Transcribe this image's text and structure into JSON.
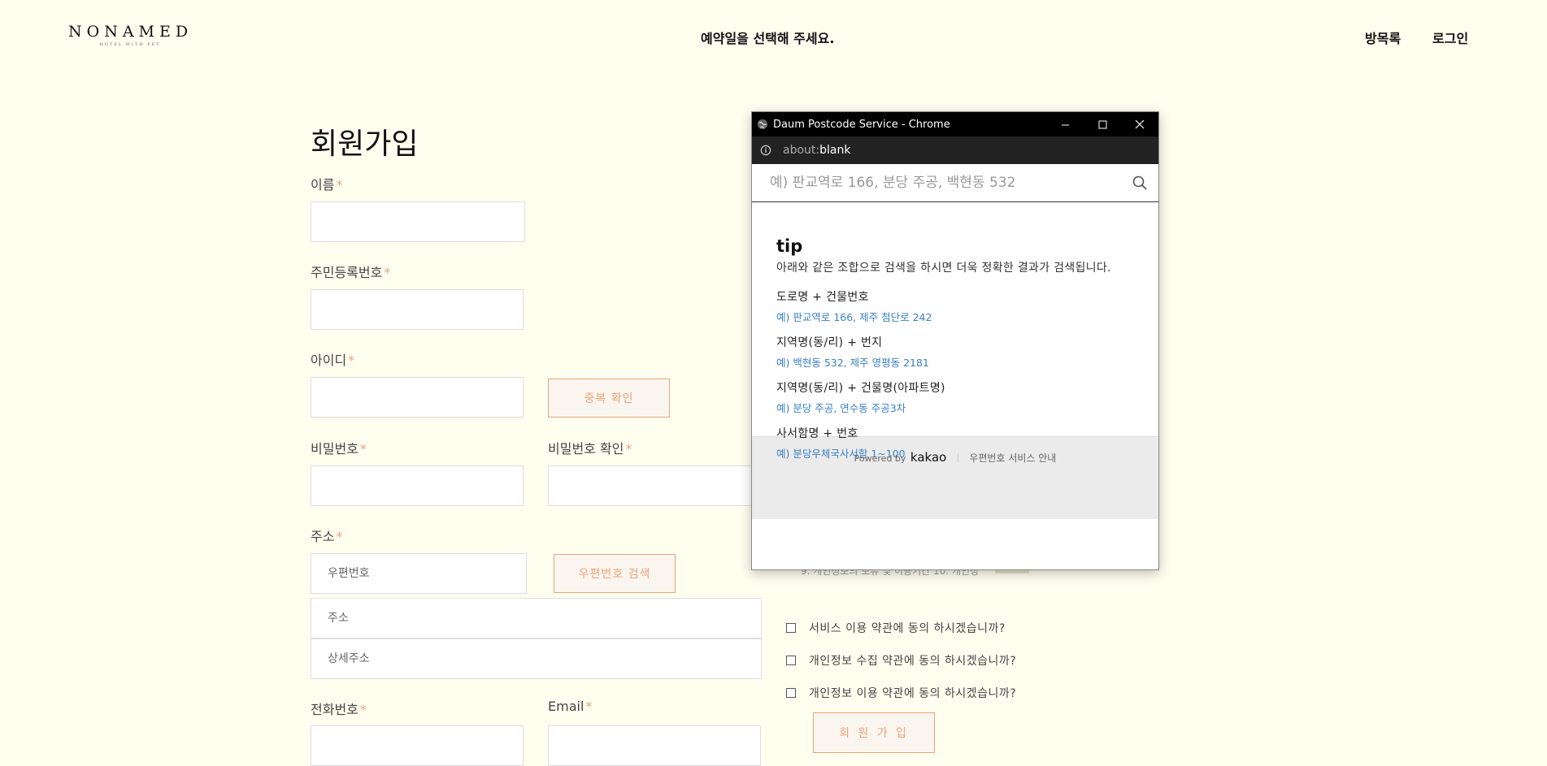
{
  "header": {
    "logo_main": "NONAMED",
    "logo_sub": "HOTEL WITH PET",
    "center_text": "예약일을 선택해 주세요.",
    "nav": [
      "방목록",
      "로그인"
    ]
  },
  "form": {
    "title": "회원가입",
    "required_mark": "*",
    "labels": {
      "name": "이름",
      "rrn": "주민등록번호",
      "id": "아이디",
      "password": "비밀번호",
      "password_confirm": "비밀번호 확인",
      "address": "주소",
      "phone": "전화번호",
      "email": "Email"
    },
    "placeholders": {
      "postcode": "우편번호",
      "address": "주소",
      "address_detail": "상세주소"
    },
    "buttons": {
      "dup_check": "중복 확인",
      "postcode_search": "우편번호 검색",
      "signup": "회 원 가 입"
    },
    "agreements": [
      "서비스 이용 약관에 동의 하시겠습니까?",
      "개인정보 수집 약관에 동의 하시겠습니까?",
      "개인정보 이용 약관에 동의 하시겠습니까?"
    ],
    "faded_text": "9. 개인정보의 보유 및 이용기간 10. 개인정"
  },
  "popup": {
    "window_title": "Daum Postcode Service - Chrome",
    "address_proto": "about:",
    "address_rest": "blank",
    "search_placeholder": "예) 판교역로 166, 분당 주공, 백현동 532",
    "tip_title": "tip",
    "tip_desc": "아래와 같은 조합으로 검색을 하시면 더욱 정확한 결과가 검색됩니다.",
    "tips": [
      {
        "heading": "도로명 + 건물번호",
        "example": "예) 판교역로 166,  제주 첨단로 242"
      },
      {
        "heading": "지역명(동/리) + 번지",
        "example": "예) 백현동 532,  제주 영평동 2181"
      },
      {
        "heading": "지역명(동/리) + 건물명(아파트명)",
        "example": "예) 분당 주공,  연수동 주공3차"
      },
      {
        "heading": "사서함명 + 번호",
        "example": "예) 분당우체국사서함 1~100"
      }
    ],
    "powered_by": "Powered by",
    "brand": "kakao",
    "guide": "우편번호 서비스 안내"
  },
  "colors": {
    "page_bg": "#fffff0",
    "accent": "#e8a37a",
    "link_blue": "#3a80c4"
  }
}
